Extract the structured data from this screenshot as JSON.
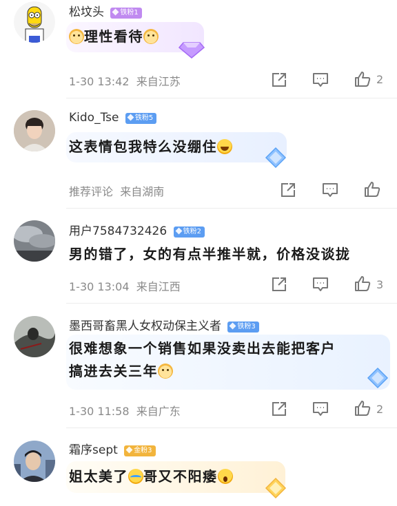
{
  "comments": [
    {
      "username": "松坟头",
      "badge": "铁粉1",
      "badge_color": "#c08af0",
      "text_before": "",
      "text_main": "理性看待",
      "time": "1-30 13:42",
      "location": "来自江苏",
      "likes": "2",
      "avatar": "simpsons-avatar"
    },
    {
      "username": "Kido_Tse",
      "badge": "铁粉5",
      "badge_color": "#5c9df2",
      "text_main": "这表情包我特么没绷住",
      "tag": "推荐评论",
      "location": "来自湖南",
      "likes": "",
      "avatar": "young-man-avatar"
    },
    {
      "username": "用户7584732426",
      "badge": "铁粉2",
      "badge_color": "#5c9df2",
      "text_main": "男的错了，女的有点半推半就，价格没谈拢",
      "time": "1-30 13:04",
      "location": "来自江西",
      "likes": "3",
      "avatar": "clouds-avatar"
    },
    {
      "username": "墨西哥畜黑人女权动保主义者",
      "badge": "铁粉3",
      "badge_color": "#5c9df2",
      "text_line1": "很难想象一个销售如果没卖出去能把客户",
      "text_line2": "搞进去关三年",
      "time": "1-30 11:58",
      "location": "来自广东",
      "likes": "2",
      "avatar": "dark-figure-avatar"
    },
    {
      "username": "霜序sept",
      "badge": "金粉3",
      "badge_color": "#f2b43c",
      "text_main_a": "姐太美了",
      "text_main_b": "哥又不阳痿",
      "avatar": "city-man-avatar"
    }
  ]
}
